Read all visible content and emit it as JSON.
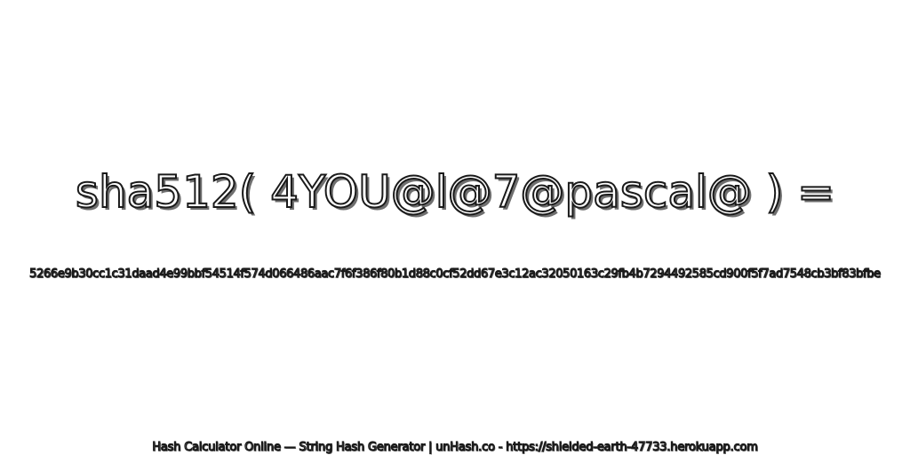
{
  "headline": "sha512( 4YOU@l@7@pascal@ ) =",
  "hash_value": "5266e9b30cc1c31daad4e99bbf54514f574d066486aac7f6f386f80b1d88c0cf52dd67e3c12ac32050163c29fb4b7294492585cd900f5f7ad7548cb3bf83bfbe",
  "footer": "Hash Calculator Online — String Hash Generator | unHash.co - https://shielded-earth-47733.herokuapp.com",
  "colors": {
    "background": "#ffffff",
    "text_fill": "#ffffff",
    "text_outline": "#1a1a1a",
    "text_shadow": "#6f6f6f"
  }
}
